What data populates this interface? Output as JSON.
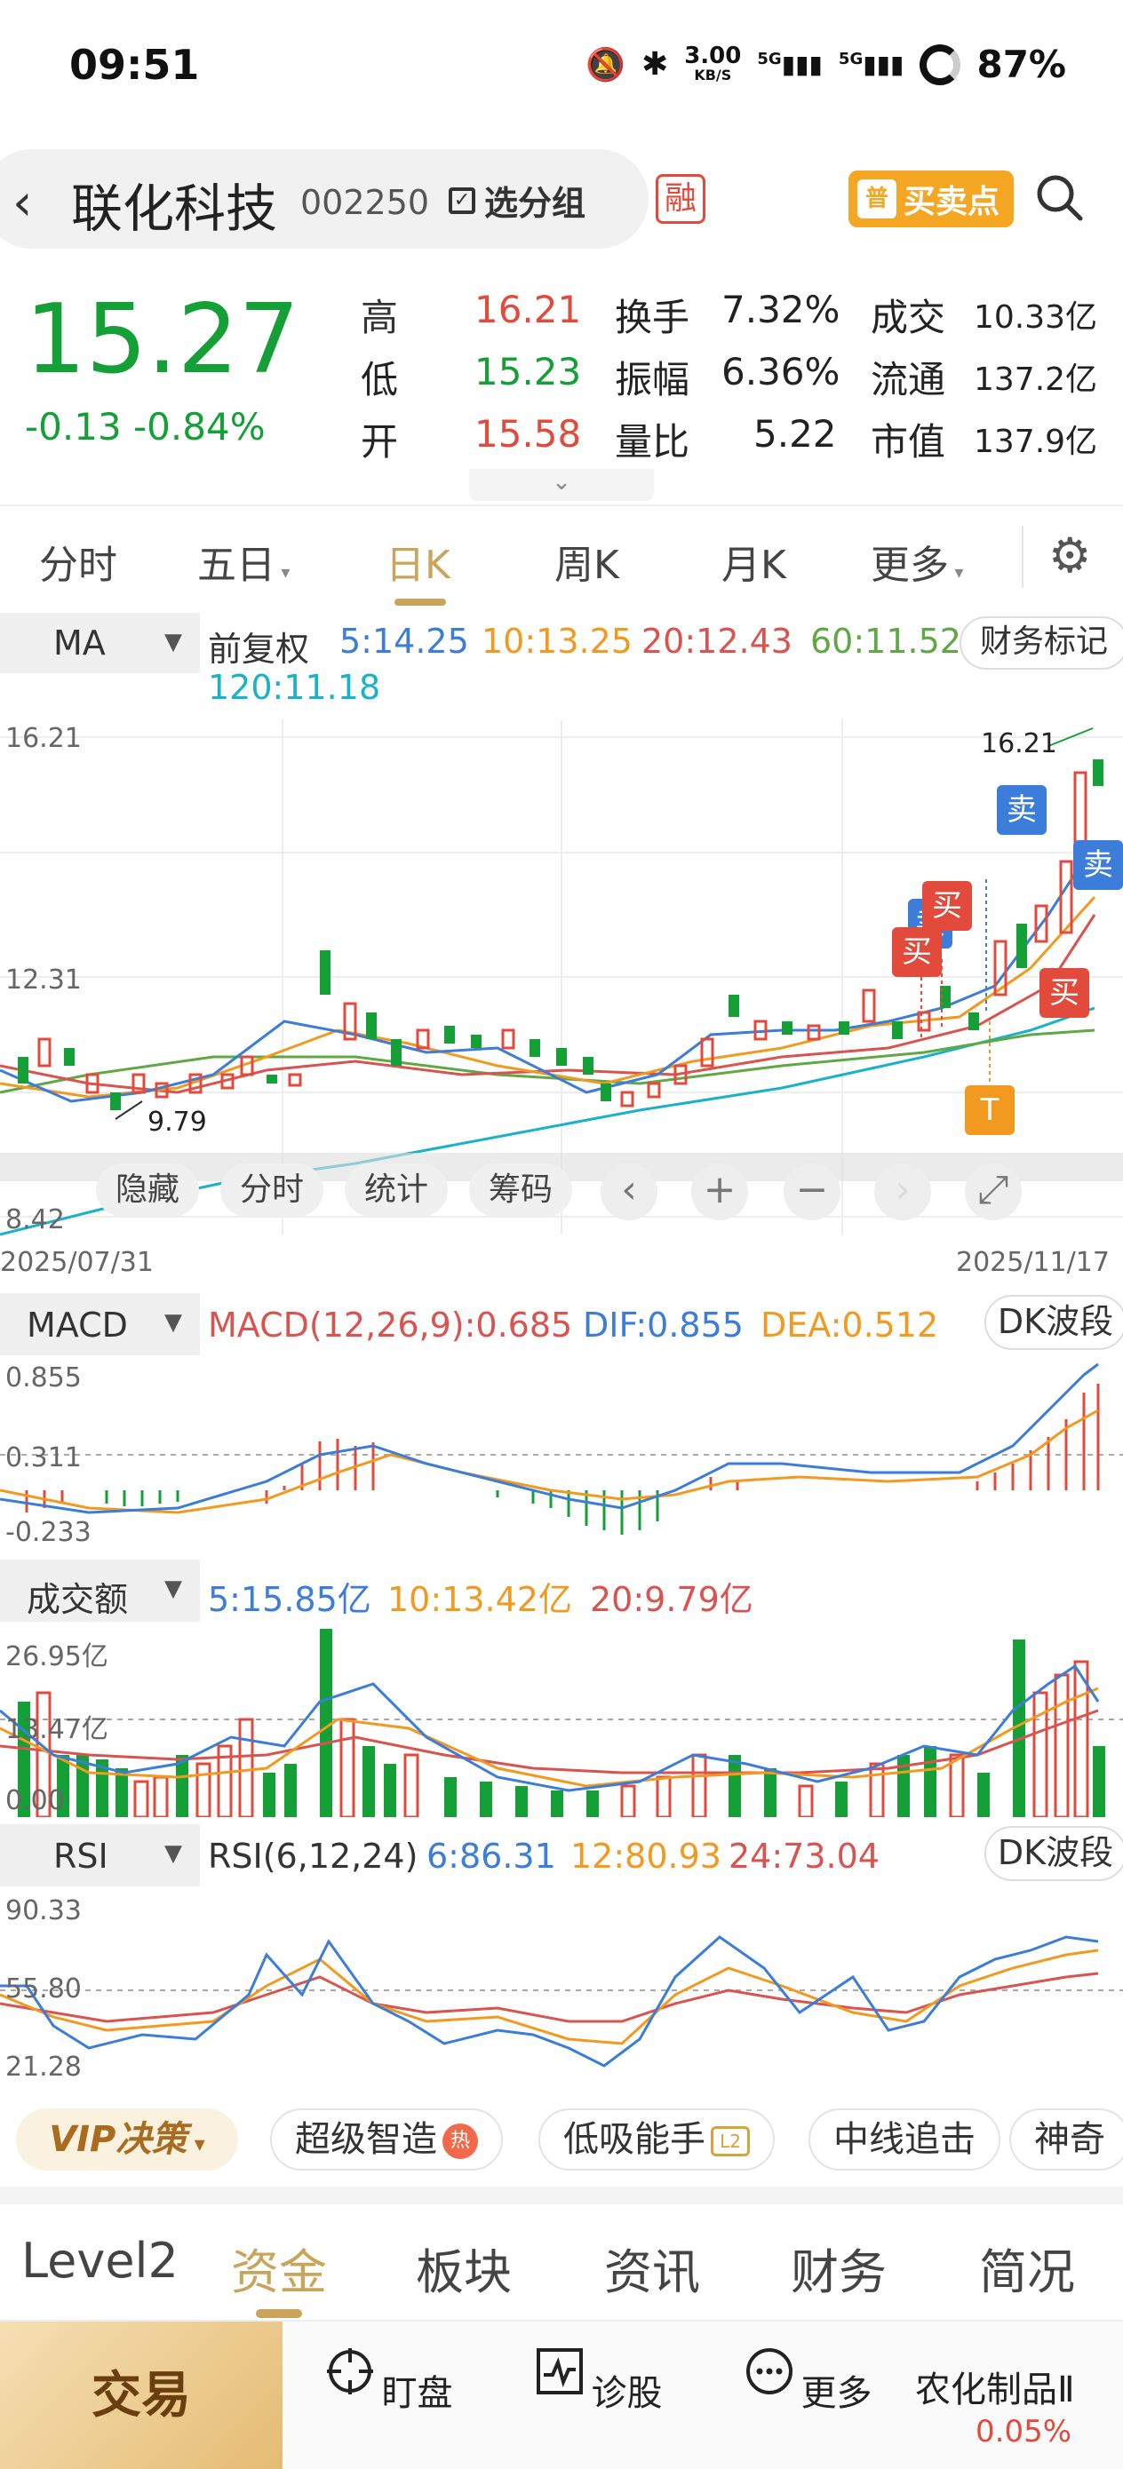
{
  "status": {
    "time": "09:51",
    "net_speed_value": "3.00",
    "net_speed_unit": "KB/S",
    "signal1": "5G",
    "signal2": "5G",
    "battery": "87%"
  },
  "header": {
    "name": "联化科技",
    "code": "002250",
    "group_btn": "选分组",
    "margin_badge": "融",
    "bsp_icon": "普",
    "bsp_label": "买卖点"
  },
  "quote": {
    "price": "15.27",
    "change": "-0.13 -0.84%",
    "high_label": "高",
    "high": "16.21",
    "low_label": "低",
    "low": "15.23",
    "open_label": "开",
    "open": "15.58",
    "turnover_label": "换手",
    "turnover": "7.32%",
    "amplitude_label": "振幅",
    "amplitude": "6.36%",
    "vol_ratio_label": "量比",
    "vol_ratio": "5.22",
    "amount_label": "成交",
    "amount": "10.33亿",
    "float_label": "流通",
    "float_cap": "137.2亿",
    "mcap_label": "市值",
    "mcap": "137.9亿"
  },
  "tabs": [
    "分时",
    "五日",
    "日K",
    "周K",
    "月K",
    "更多"
  ],
  "ma": {
    "label": "MA",
    "adj": "前复权",
    "ma5": "5:14.25",
    "ma10": "10:13.25",
    "ma20": "20:12.43",
    "ma60": "60:11.52",
    "ma120": "120:11.18",
    "fin_mark": "财务标记"
  },
  "kline": {
    "y_top": "16.21",
    "y_mid": "12.31",
    "y_bottom": "8.42",
    "date_start": "2025/07/31",
    "date_end": "2025/11/17",
    "hi_label": "16.21",
    "lo_label": "9.79",
    "tags": {
      "sell1": "卖",
      "sell2": "卖",
      "sell3": "卖",
      "buy1": "买",
      "buy2": "买",
      "buy3": "买",
      "t": "T"
    }
  },
  "chart_tools": {
    "hide": "隐藏",
    "intraday": "分时",
    "stats": "统计",
    "chips": "筹码",
    "prev": "‹",
    "zoom_in": "+",
    "zoom_out": "−",
    "next": "›",
    "fullscreen": "⤢"
  },
  "macd": {
    "label": "MACD",
    "title": "MACD(12,26,9):0.685",
    "dif": "DIF:0.855",
    "dea": "DEA:0.512",
    "y_top": "0.855",
    "y_mid": "0.311",
    "y_bottom": "-0.233",
    "btn": "DK波段"
  },
  "amount": {
    "label": "成交额",
    "ma5": "5:15.85亿",
    "ma10": "10:13.42亿",
    "ma20": "20:9.79亿",
    "y_top": "26.95亿",
    "y_mid": "13.47亿",
    "y_bottom": "0.00"
  },
  "rsi": {
    "label": "RSI",
    "title": "RSI(6,12,24)",
    "r6": "6:86.31",
    "r12": "12:80.93",
    "r24": "24:73.04",
    "y_top": "90.33",
    "y_mid": "55.80",
    "y_bottom": "21.28",
    "btn": "DK波段"
  },
  "strategies": {
    "vip": "VIP决策",
    "items": [
      "超级智造",
      "低吸能手",
      "中线追击",
      "神奇"
    ],
    "hot": "热",
    "l2": "L2"
  },
  "bottom_tabs": [
    "Level2",
    "资金",
    "板块",
    "资讯",
    "财务",
    "简况"
  ],
  "nav": {
    "trade": "交易",
    "watch": "盯盘",
    "diagnose": "诊股",
    "more": "更多",
    "index_name": "农化制品Ⅱ",
    "index_change": "0.05%"
  },
  "colors": {
    "up": "#e24a3b",
    "down": "#14a036",
    "accent": "#c9a55c",
    "ma5": "#3b7dd8",
    "ma10": "#f29a1f",
    "ma20": "#d9534f",
    "ma60": "#5fa845",
    "ma120": "#1ab2c8"
  }
}
